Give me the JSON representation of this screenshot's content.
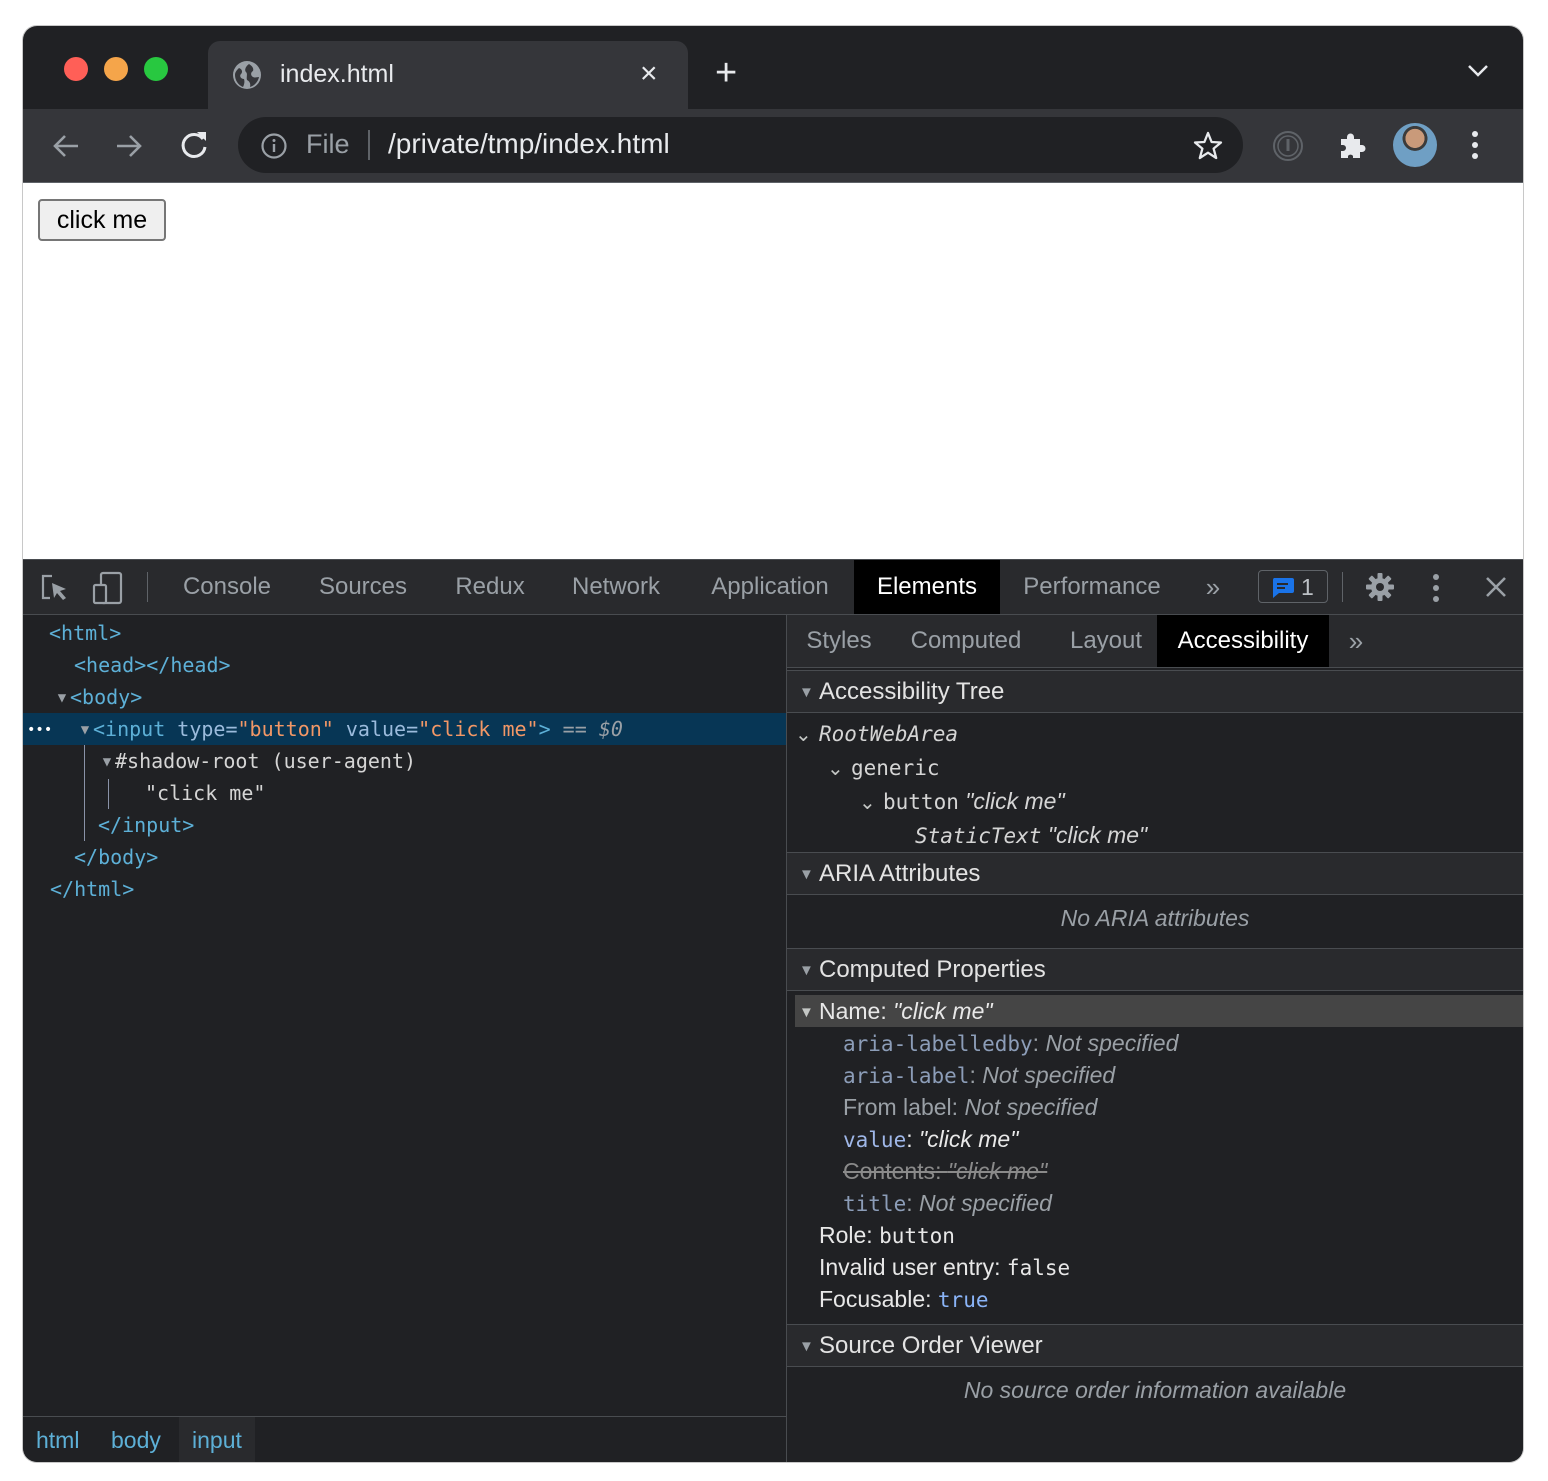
{
  "browser": {
    "tab": {
      "title": "index.html",
      "close_icon": "×",
      "favicon": "globe-icon"
    },
    "new_tab_label": "+",
    "toolbar": {
      "back_icon": "arrow-left-icon",
      "forward_icon": "arrow-right-icon",
      "reload_icon": "reload-icon",
      "omnibox": {
        "scheme_label": "File",
        "url": "/private/tmp/index.html"
      },
      "extensions": [
        "password-manager-icon",
        "puzzle-icon"
      ],
      "profile_avatar": "avatar",
      "menu_icon": "kebab-icon"
    }
  },
  "page": {
    "button_value": "click me"
  },
  "devtools": {
    "tabs": [
      "Console",
      "Sources",
      "Redux",
      "Network",
      "Application",
      "Elements",
      "Performance"
    ],
    "active_tab": "Elements",
    "more_tabs_label": "»",
    "issues_count": "1",
    "elements_tree": {
      "html_open": "<html>",
      "head": "<head></head>",
      "body_open": "<body>",
      "selected": {
        "ellipsis": "•••",
        "tag_open": "<input",
        "attr1_name": "type",
        "attr1_value": "\"button\"",
        "attr2_name": "value",
        "attr2_value": "\"click me\"",
        "tag_close": ">",
        "eq": "==",
        "dollar": "$0"
      },
      "shadow_root": "#shadow-root (user-agent)",
      "text_node": "\"click me\"",
      "input_close": "</input>",
      "body_close": "</body>",
      "html_close": "</html>"
    },
    "breadcrumbs": [
      "html",
      "body",
      "input"
    ],
    "sidebar": {
      "tabs": [
        "Styles",
        "Computed",
        "Layout",
        "Accessibility"
      ],
      "active_tab": "Accessibility",
      "more_label": "»",
      "accessibility_tree": {
        "header": "Accessibility Tree",
        "nodes": [
          {
            "role": "RootWebArea",
            "name": ""
          },
          {
            "role": "generic",
            "name": ""
          },
          {
            "role": "button",
            "name": "\"click me\""
          },
          {
            "role": "StaticText",
            "name": "\"click me\""
          }
        ]
      },
      "aria_attributes": {
        "header": "ARIA Attributes",
        "empty": "No ARIA attributes"
      },
      "computed_properties": {
        "header": "Computed Properties",
        "name_label": "Name: ",
        "name_value": "\"click me\"",
        "sources": [
          {
            "key": "aria-labelledby",
            "sep": ": ",
            "value": "Not specified"
          },
          {
            "key": "aria-label",
            "sep": ": ",
            "value": "Not specified"
          },
          {
            "key": "From label",
            "sep": ": ",
            "value": "Not specified"
          },
          {
            "key": "value",
            "sep": ": ",
            "value": "\"click me\""
          },
          {
            "key": "Contents",
            "sep": ": ",
            "value": "\"click me\""
          },
          {
            "key": "title",
            "sep": ": ",
            "value": "Not specified"
          }
        ],
        "role_label": "Role: ",
        "role_value": "button",
        "invalid_label": "Invalid user entry: ",
        "invalid_value": "false",
        "focusable_label": "Focusable: ",
        "focusable_value": "true"
      },
      "source_order": {
        "header": "Source Order Viewer",
        "empty": "No source order information available"
      }
    }
  }
}
